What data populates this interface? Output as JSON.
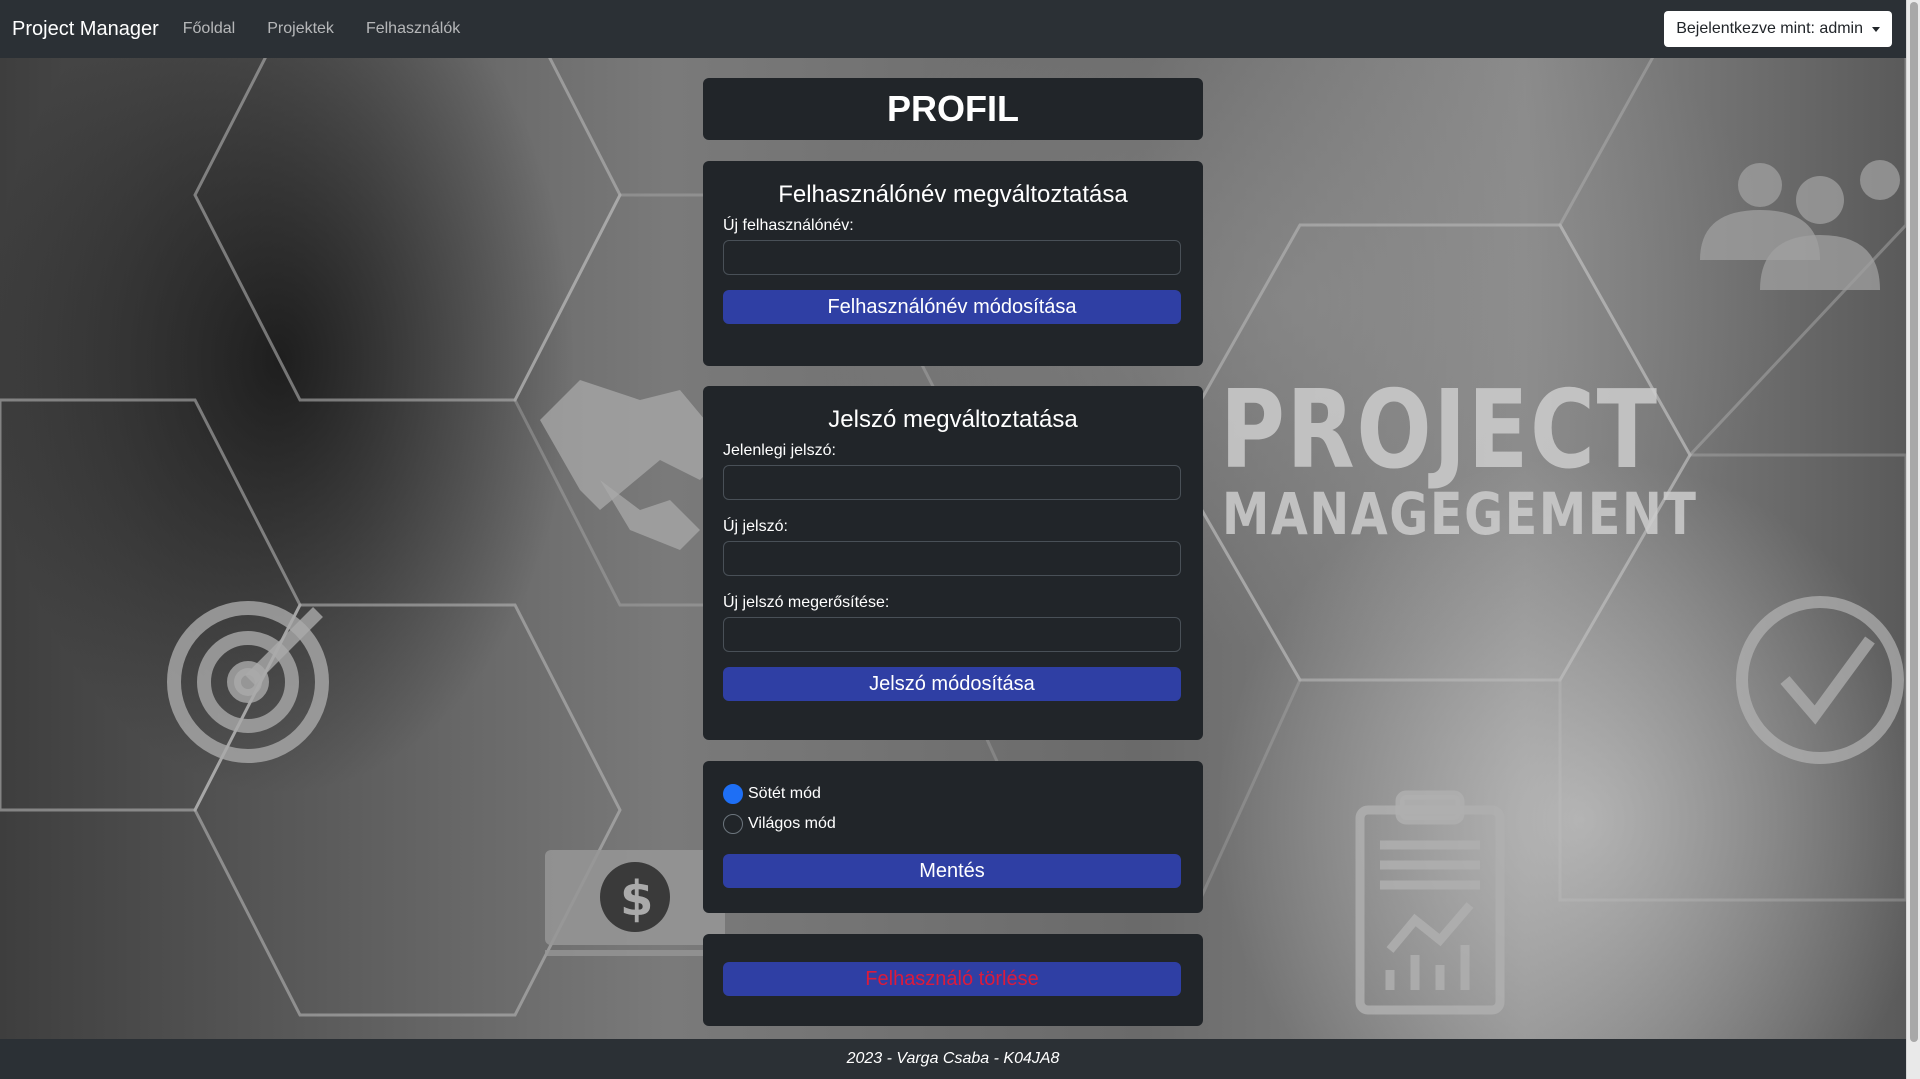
{
  "navbar": {
    "brand": "Project Manager",
    "links": [
      "Főoldal",
      "Projektek",
      "Felhasználók"
    ],
    "user_menu": "Bejelentkezve mint: admin"
  },
  "page_title": "PROFIL",
  "username_form": {
    "heading": "Felhasználónév megváltoztatása",
    "new_username_label": "Új felhasználónév:",
    "new_username_value": "",
    "submit": "Felhasználónév módosítása"
  },
  "password_form": {
    "heading": "Jelszó megváltoztatása",
    "current_label": "Jelenlegi jelszó:",
    "new_label": "Új jelszó:",
    "confirm_label": "Új jelszó megerősítése:",
    "submit": "Jelszó módosítása"
  },
  "theme_form": {
    "dark_label": "Sötét mód",
    "light_label": "Világos mód",
    "selected": "dark",
    "submit": "Mentés"
  },
  "delete_form": {
    "submit": "Felhasználó törlése"
  },
  "background": {
    "word_1": "PROJECT",
    "word_2": "MANAGEGEMENT"
  },
  "footer": "2023 - Varga Csaba - K04JA8",
  "colors": {
    "navbar": "#2b3035",
    "panel": "#212529",
    "button": "#2f3fa4",
    "radio_checked": "#1e6ff5",
    "danger_text": "#dc1b3b"
  }
}
